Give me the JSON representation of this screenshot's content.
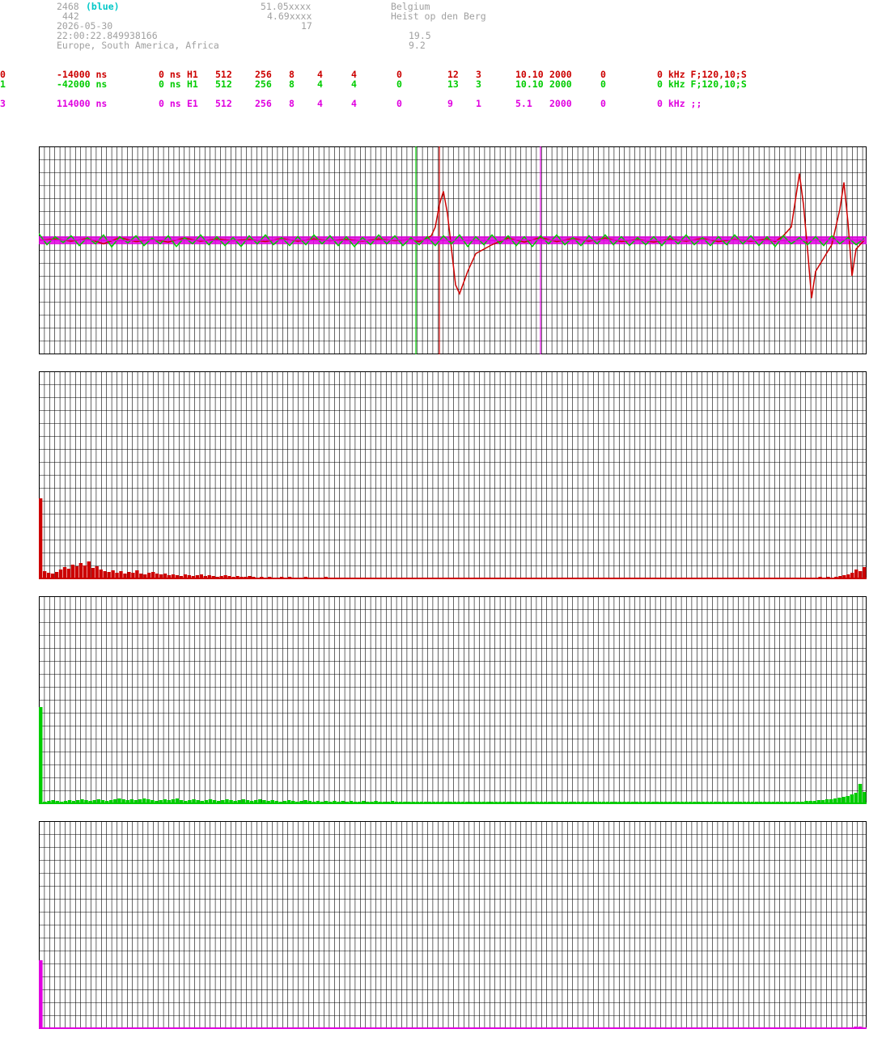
{
  "header": {
    "station_id": "2468",
    "station_color": "(blue)",
    "station_sub": "442",
    "date": "2026-05-30",
    "time": "22:00:22.849938166",
    "region": "Europe, South America, Africa",
    "lat": "51.05xxxx",
    "lon": "4.69xxxx",
    "alt": "17",
    "country": "Belgium",
    "city": "Heist op den Berg",
    "val1": "19.5",
    "val2": "9.2"
  },
  "channels": [
    {
      "idx": "0",
      "offset": "-14000 ns",
      "delay": "0 ns",
      "type": "H1",
      "n1": "512",
      "n2": "256",
      "n3": "8",
      "n4": "4",
      "n5": "4",
      "n6": "0",
      "n7": "12",
      "n8": "3",
      "n9": "10.10",
      "n10": "2000",
      "n11": "0",
      "filter": "0 kHz F;120,10;S",
      "color": "#cc0000"
    },
    {
      "idx": "1",
      "offset": "-42000 ns",
      "delay": "0 ns",
      "type": "H1",
      "n1": "512",
      "n2": "256",
      "n3": "8",
      "n4": "4",
      "n5": "4",
      "n6": "0",
      "n7": "13",
      "n8": "3",
      "n9": "10.10",
      "n10": "2000",
      "n11": "0",
      "filter": "0 kHz F;120,10;S",
      "color": "#00cc00"
    },
    {
      "idx": "3",
      "offset": "114000 ns",
      "delay": "0 ns",
      "type": "E1",
      "n1": "512",
      "n2": "256",
      "n3": "8",
      "n4": "4",
      "n5": "4",
      "n6": "0",
      "n7": "9",
      "n8": "1",
      "n9": "5.1",
      "n10": "2000",
      "n11": "0",
      "filter": "0 kHz ;;",
      "color": "#e000e0"
    }
  ],
  "chart_data": [
    {
      "type": "line",
      "series": [
        {
          "color": "#cc0000",
          "x": [
            0,
            20,
            40,
            60,
            80,
            100,
            120,
            140,
            160,
            180,
            200,
            220,
            240,
            260,
            280,
            300,
            320,
            340,
            360,
            380,
            400,
            420,
            440,
            460,
            470,
            480,
            485,
            490,
            495,
            500,
            505,
            510,
            515,
            520,
            530,
            540,
            560,
            580,
            600,
            620,
            640,
            660,
            680,
            700,
            720,
            740,
            760,
            780,
            800,
            820,
            840,
            860,
            880,
            900,
            910,
            920,
            930,
            940,
            945,
            950,
            955,
            960,
            970,
            980,
            990,
            995,
            1000,
            1005,
            1010,
            1020
          ],
          "y": [
            0,
            3,
            -2,
            4,
            -8,
            6,
            -3,
            2,
            -4,
            5,
            -2,
            3,
            -1,
            2,
            -3,
            4,
            -2,
            3,
            -1,
            2,
            -2,
            3,
            -1,
            2,
            -3,
            5,
            10,
            30,
            80,
            110,
            60,
            -20,
            -100,
            -120,
            -70,
            -30,
            -10,
            5,
            -4,
            6,
            -3,
            4,
            -2,
            5,
            -3,
            2,
            -4,
            3,
            -2,
            4,
            -3,
            2,
            -2,
            3,
            -3,
            10,
            30,
            150,
            80,
            -20,
            -130,
            -70,
            -40,
            -10,
            70,
            130,
            40,
            -80,
            -20,
            0
          ]
        },
        {
          "color": "#00cc00",
          "x": [
            0,
            10,
            20,
            30,
            40,
            50,
            60,
            70,
            80,
            90,
            100,
            110,
            120,
            130,
            140,
            150,
            160,
            170,
            180,
            190,
            200,
            210,
            220,
            230,
            240,
            250,
            260,
            270,
            280,
            290,
            300,
            310,
            320,
            330,
            340,
            350,
            360,
            370,
            380,
            390,
            400,
            410,
            420,
            430,
            440,
            450,
            460,
            470,
            480,
            490,
            500,
            510,
            520,
            530,
            540,
            550,
            560,
            570,
            580,
            590,
            600,
            610,
            620,
            630,
            640,
            650,
            660,
            670,
            680,
            690,
            700,
            710,
            720,
            730,
            740,
            750,
            760,
            770,
            780,
            790,
            800,
            810,
            820,
            830,
            840,
            850,
            860,
            870,
            880,
            890,
            900,
            910,
            920,
            930,
            940,
            950,
            960,
            970,
            980,
            990,
            1000,
            1010,
            1020
          ],
          "y": [
            15,
            -10,
            8,
            -5,
            10,
            -12,
            6,
            -8,
            12,
            -15,
            8,
            -6,
            10,
            -12,
            5,
            -8,
            10,
            -14,
            6,
            -8,
            12,
            -10,
            8,
            -12,
            6,
            -14,
            10,
            -8,
            12,
            -10,
            6,
            -12,
            8,
            -10,
            12,
            -8,
            10,
            -12,
            8,
            -14,
            6,
            -10,
            12,
            -8,
            10,
            -12,
            6,
            -10,
            8,
            -12,
            10,
            -8,
            12,
            -14,
            8,
            -10,
            12,
            -8,
            10,
            -12,
            8,
            -14,
            10,
            -8,
            12,
            -10,
            6,
            -12,
            10,
            -8,
            12,
            -10,
            8,
            -12,
            6,
            -10,
            8,
            -12,
            10,
            -8,
            12,
            -10,
            6,
            -12,
            8,
            -10,
            12,
            -8,
            10,
            -12,
            8,
            -14,
            10,
            -8,
            6,
            -10,
            8,
            -12,
            10,
            -8,
            6,
            -10,
            4
          ]
        },
        {
          "color": "#e000e0",
          "x": [
            0,
            50,
            100,
            150,
            200,
            250,
            300,
            350,
            400,
            450,
            500,
            550,
            600,
            650,
            700,
            750,
            800,
            850,
            900,
            950,
            1000,
            1020
          ],
          "y": [
            0,
            1,
            -1,
            1,
            0,
            -1,
            1,
            0,
            -1,
            1,
            0,
            -1,
            1,
            0,
            1,
            -1,
            0,
            1,
            -1,
            0,
            1,
            0
          ]
        }
      ],
      "markers": [
        {
          "x": 466,
          "color": "#00cc00"
        },
        {
          "x": 495,
          "color": "#cc0000"
        },
        {
          "x": 620,
          "color": "#e000e0"
        }
      ]
    },
    {
      "type": "bar",
      "series": [
        {
          "color": "#cc0000",
          "values": [
            100,
            10,
            8,
            7,
            9,
            12,
            15,
            13,
            18,
            16,
            20,
            17,
            22,
            14,
            16,
            12,
            10,
            9,
            11,
            8,
            10,
            7,
            9,
            8,
            11,
            7,
            6,
            8,
            9,
            7,
            6,
            7,
            5,
            6,
            5,
            4,
            6,
            5,
            4,
            5,
            6,
            4,
            5,
            4,
            3,
            4,
            5,
            4,
            3,
            4,
            3,
            3,
            4,
            3,
            2,
            3,
            2,
            3,
            2,
            2,
            3,
            2,
            3,
            2,
            2,
            2,
            3,
            2,
            2,
            2,
            2,
            3,
            2,
            2,
            2,
            2,
            2,
            2,
            2,
            2,
            2,
            2,
            2,
            2,
            2,
            2,
            2,
            2,
            2,
            2,
            2,
            2,
            2,
            2,
            2,
            2,
            2,
            2,
            2,
            2,
            2,
            2,
            2,
            2,
            2,
            2,
            2,
            2,
            2,
            2,
            2,
            2,
            2,
            2,
            2,
            2,
            2,
            2,
            2,
            2,
            2,
            2,
            2,
            2,
            2,
            2,
            2,
            2,
            2,
            2,
            2,
            2,
            2,
            2,
            2,
            2,
            2,
            2,
            2,
            2,
            2,
            2,
            2,
            2,
            2,
            2,
            2,
            2,
            2,
            2,
            2,
            2,
            2,
            2,
            2,
            2,
            2,
            2,
            2,
            2,
            2,
            2,
            2,
            2,
            2,
            2,
            2,
            2,
            2,
            2,
            2,
            2,
            2,
            2,
            2,
            2,
            2,
            2,
            2,
            2,
            2,
            2,
            2,
            2,
            2,
            2,
            2,
            2,
            2,
            2,
            2,
            2,
            2,
            2,
            3,
            2,
            3,
            2,
            3,
            4,
            5,
            6,
            8,
            12,
            10,
            15
          ]
        }
      ]
    },
    {
      "type": "bar",
      "series": [
        {
          "color": "#00cc00",
          "values": [
            120,
            3,
            4,
            5,
            4,
            3,
            4,
            5,
            4,
            5,
            6,
            5,
            4,
            5,
            6,
            5,
            4,
            5,
            6,
            7,
            6,
            5,
            6,
            5,
            6,
            7,
            6,
            5,
            4,
            5,
            6,
            5,
            6,
            7,
            5,
            4,
            5,
            6,
            5,
            4,
            5,
            6,
            5,
            4,
            5,
            6,
            5,
            4,
            5,
            6,
            5,
            4,
            5,
            6,
            5,
            4,
            5,
            4,
            3,
            4,
            5,
            4,
            3,
            4,
            5,
            4,
            3,
            4,
            3,
            4,
            3,
            4,
            3,
            4,
            3,
            4,
            3,
            3,
            4,
            3,
            3,
            4,
            3,
            3,
            3,
            4,
            3,
            3,
            3,
            3,
            3,
            3,
            3,
            3,
            3,
            3,
            3,
            3,
            3,
            3,
            3,
            3,
            3,
            3,
            3,
            3,
            3,
            3,
            3,
            3,
            3,
            3,
            3,
            3,
            3,
            3,
            3,
            3,
            3,
            3,
            3,
            3,
            3,
            3,
            3,
            3,
            3,
            3,
            3,
            3,
            3,
            3,
            3,
            3,
            3,
            3,
            3,
            3,
            3,
            3,
            3,
            3,
            3,
            3,
            3,
            3,
            3,
            3,
            3,
            3,
            3,
            3,
            3,
            3,
            3,
            3,
            3,
            3,
            3,
            3,
            3,
            3,
            3,
            3,
            3,
            3,
            3,
            3,
            3,
            3,
            3,
            3,
            3,
            3,
            3,
            3,
            3,
            3,
            3,
            3,
            3,
            3,
            3,
            3,
            3,
            4,
            4,
            4,
            5,
            5,
            6,
            6,
            7,
            8,
            9,
            10,
            12,
            14,
            25,
            15
          ]
        }
      ]
    },
    {
      "type": "bar",
      "series": [
        {
          "color": "#e000e0",
          "values": [
            85,
            2,
            2,
            1,
            2,
            1,
            2,
            1,
            1,
            2,
            1,
            1,
            2,
            1,
            1,
            1,
            2,
            1,
            1,
            1,
            1,
            2,
            1,
            1,
            1,
            1,
            1,
            1,
            1,
            1,
            1,
            1,
            1,
            1,
            1,
            1,
            1,
            1,
            1,
            1,
            1,
            1,
            1,
            1,
            1,
            1,
            1,
            1,
            1,
            1,
            1,
            1,
            1,
            1,
            1,
            1,
            1,
            1,
            1,
            1,
            1,
            1,
            1,
            1,
            1,
            1,
            1,
            1,
            1,
            1,
            1,
            1,
            1,
            1,
            1,
            1,
            1,
            1,
            1,
            1,
            1,
            1,
            1,
            1,
            1,
            1,
            1,
            1,
            1,
            1,
            1,
            1,
            1,
            1,
            1,
            1,
            1,
            1,
            1,
            1,
            1,
            1,
            1,
            1,
            1,
            1,
            1,
            1,
            1,
            1,
            1,
            1,
            1,
            1,
            1,
            1,
            1,
            1,
            1,
            1,
            1,
            1,
            1,
            1,
            1,
            1,
            1,
            1,
            1,
            1,
            1,
            1,
            1,
            1,
            1,
            1,
            1,
            1,
            1,
            1,
            1,
            1,
            1,
            1,
            1,
            1,
            1,
            1,
            1,
            1,
            1,
            1,
            1,
            1,
            1,
            1,
            1,
            1,
            1,
            1,
            1,
            1,
            1,
            1,
            1,
            1,
            1,
            1,
            1,
            1,
            1,
            1,
            1,
            1,
            1,
            1,
            1,
            1,
            1,
            1,
            1,
            1,
            1,
            1,
            1,
            1,
            1,
            1,
            1,
            1,
            1,
            2,
            2,
            3,
            3,
            2
          ]
        }
      ]
    }
  ]
}
